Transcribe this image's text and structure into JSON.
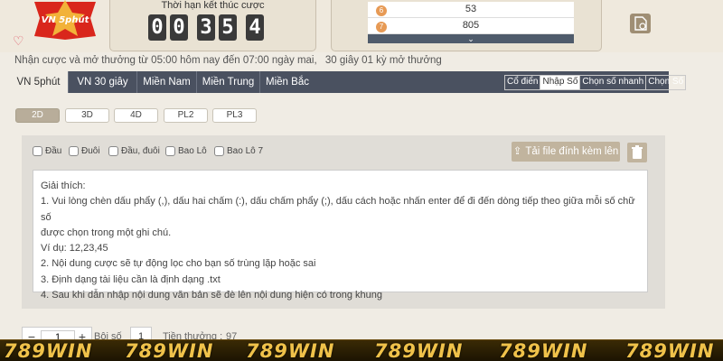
{
  "header": {
    "logo_text": "VN 5phút",
    "timer_title": "Thời hạn kết thúc cược",
    "timer_digits": [
      "0",
      "0",
      "3",
      "5",
      "4"
    ],
    "results": [
      {
        "ball": "6",
        "value": "53"
      },
      {
        "ball": "7",
        "value": "805"
      }
    ],
    "expand_icon": "chevron-down-icon"
  },
  "notice": {
    "bet_time": "Nhận cược và mở thưởng từ 05:00 hôm nay đến 07:00 ngày mai,",
    "draw_interval": "30 giây 01 kỳ mở thưởng"
  },
  "nav": {
    "tabs": [
      "VN 5phút",
      "VN 30 giây",
      "Miền Nam",
      "Miền Trung",
      "Miền Bắc"
    ],
    "active_tab": 0,
    "modes": [
      "Cổ điển",
      "Nhập Số",
      "Chọn số nhanh",
      "Chọn Số"
    ],
    "active_mode": 1
  },
  "game_tabs": {
    "items": [
      "2D",
      "3D",
      "4D",
      "PL2",
      "PL3"
    ],
    "active": 0
  },
  "panel": {
    "checkboxes": [
      "Đầu",
      "Đuôi",
      "Đầu, đuôi",
      "Bao Lô",
      "Bao Lô 7"
    ],
    "upload_label": "Tải file đính kèm lên",
    "explain": {
      "title": "Giải thích:",
      "line1": "1. Vui lòng chèn dấu phẩy (,), dấu hai chấm (:), dấu chấm phẩy (;), dấu cách hoặc nhấn enter để đi đến dòng tiếp theo giữa mỗi số chữ số",
      "line1b": "được chọn trong một ghi chú.",
      "example": "Ví dụ: 12,23,45",
      "line2": "2. Nội dung cược sẽ tự động lọc cho bạn số trùng lặp hoặc sai",
      "line3": "3. Định dạng tài liệu cần là định dạng .txt",
      "line4": "4. Sau khi dẫn nhập nội dung văn bản sẽ đè lên nội dung hiện có trong khung"
    }
  },
  "bottom": {
    "quantity_value": "1",
    "minus": "−",
    "plus": "+",
    "multiplier_label": "Bội số",
    "multiplier_value": "1",
    "reward_label": "Tiền thưởng :",
    "reward_value": "97"
  },
  "banner": {
    "brand": "789WIN",
    "color": "#f0c24a"
  },
  "colors": {
    "nav_bg": "#4a5160",
    "accent_tan": "#c1b49e",
    "ball": "#e79a55"
  }
}
